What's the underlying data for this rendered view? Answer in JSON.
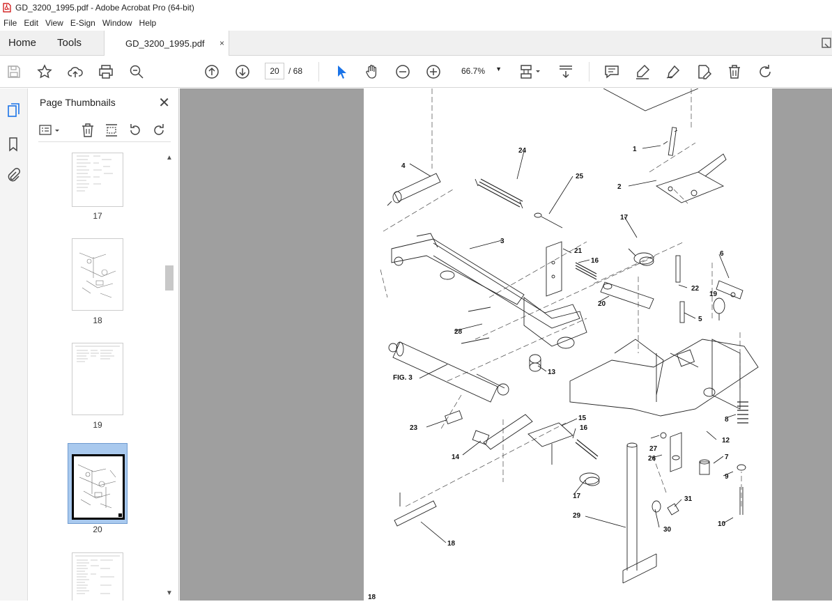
{
  "window": {
    "title": "GD_3200_1995.pdf - Adobe Acrobat Pro (64-bit)"
  },
  "menu": [
    "File",
    "Edit",
    "View",
    "E-Sign",
    "Window",
    "Help"
  ],
  "tabs": {
    "home": "Home",
    "tools": "Tools",
    "document": "GD_3200_1995.pdf",
    "close": "×"
  },
  "toolbar": {
    "current_page": "20",
    "page_total": "/  68",
    "zoom": "66.7%"
  },
  "panel": {
    "title": "Page Thumbnails",
    "close": "✕",
    "thumbnails": [
      {
        "label": "17"
      },
      {
        "label": "18"
      },
      {
        "label": "19"
      },
      {
        "label": "20"
      }
    ]
  },
  "drawing": {
    "caption": "FIG. 3",
    "page_number": "18",
    "part_labels": [
      "1",
      "2",
      "3",
      "4",
      "5",
      "6",
      "7",
      "8",
      "9",
      "10",
      "12",
      "13",
      "14",
      "15",
      "16",
      "16",
      "17",
      "17",
      "18",
      "19",
      "20",
      "21",
      "22",
      "23",
      "24",
      "25",
      "26",
      "27",
      "28",
      "29",
      "30",
      "31"
    ]
  }
}
